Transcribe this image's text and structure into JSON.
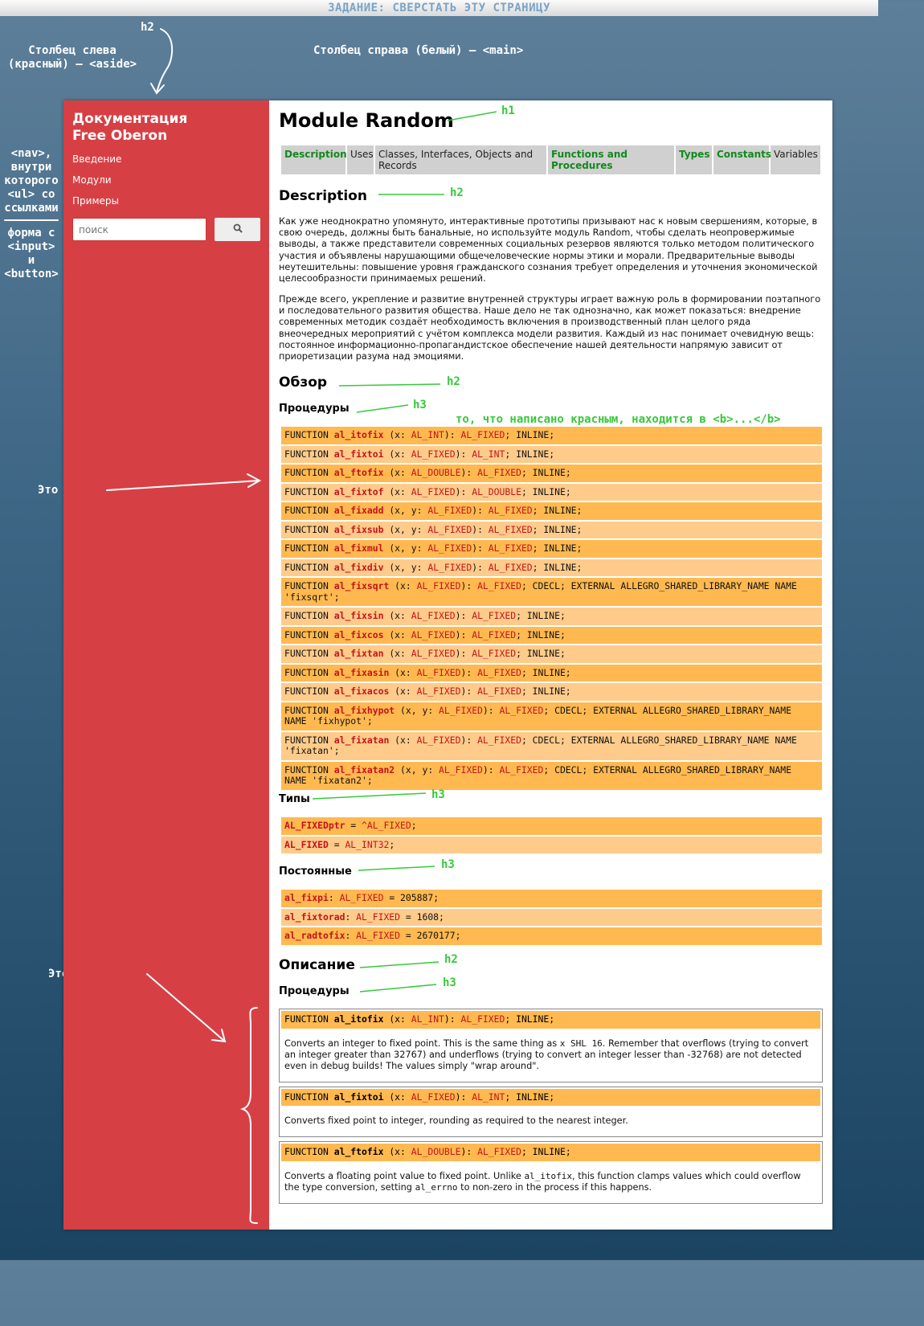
{
  "banner": "ЗАДАНИЕ: СВЕРСТАТЬ ЭТУ СТРАНИЦУ",
  "annotations": {
    "h2_top": "h2",
    "left_col": [
      "Столбец слева",
      "(красный) — <aside>"
    ],
    "right_col": "Столбец справа (белый) — <main>",
    "nav": [
      "<nav>,",
      "внутри",
      "которого",
      "<ul> со",
      "ссылками"
    ],
    "form": [
      "форма с",
      "<input>",
      "и",
      "<button>"
    ],
    "h1": "h1",
    "h2": "h2",
    "h3": "h3",
    "bold_note": "то, что написано красным, находится в <b>...</b>",
    "ul1": "Это <ul>",
    "ul2": "Это тоже <ul>"
  },
  "aside": {
    "brand_line1": "Документация",
    "brand_line2": "Free Oberon",
    "nav": [
      "Введение",
      "Модули",
      "Примеры"
    ],
    "search_placeholder": "поиск",
    "search_icon": "search-icon"
  },
  "main": {
    "title": "Module Random",
    "tabs": [
      "Description",
      "Uses",
      "Classes, Interfaces, Objects and Records",
      "Functions and Procedures",
      "Types",
      "Constants",
      "Variables"
    ],
    "desc_heading": "Description",
    "para1": "Как уже неоднократно упомянуто, интерактивные прототипы призывают нас к новым свершениям, которые, в свою очередь, должны быть банальные, но используйте модуль Random, чтобы сделать неопровержимые выводы, а также представители современных социальных резервов являются только методом политического участия и объявлены нарушающими общечеловеческие нормы этики и морали. Предварительные выводы неутешительны: повышение уровня гражданского сознания требует определения и уточнения экономической целесообразности принимаемых решений.",
    "para2": "Прежде всего, укрепление и развитие внутренней структуры играет важную роль в формировании поэтапного и последовательного развития общества. Наше дело не так однозначно, как может показаться: внедрение современных методик создаёт необходимость включения в производственный план целого ряда внеочередных мероприятий с учётом комплекса модели развития. Каждый из нас понимает очевидную вещь: постоянное информационно-пропагандистское обеспечение нашей деятельности напрямую зависит от приоретизации разума над эмоциями.",
    "overview_heading": "Обзор",
    "procedures_heading": "Процедуры",
    "procedures": [
      [
        "FUNCTION ",
        "al_itofix",
        " (x: ",
        "AL_INT",
        "): ",
        "AL_FIXED",
        "; INLINE;"
      ],
      [
        "FUNCTION ",
        "al_fixtoi",
        " (x: ",
        "AL_FIXED",
        "): ",
        "AL_INT",
        "; INLINE;"
      ],
      [
        "FUNCTION ",
        "al_ftofix",
        " (x: ",
        "AL_DOUBLE",
        "): ",
        "AL_FIXED",
        "; INLINE;"
      ],
      [
        "FUNCTION ",
        "al_fixtof",
        " (x: ",
        "AL_FIXED",
        "): ",
        "AL_DOUBLE",
        "; INLINE;"
      ],
      [
        "FUNCTION ",
        "al_fixadd",
        " (x, y: ",
        "AL_FIXED",
        "): ",
        "AL_FIXED",
        "; INLINE;"
      ],
      [
        "FUNCTION ",
        "al_fixsub",
        " (x, y: ",
        "AL_FIXED",
        "): ",
        "AL_FIXED",
        "; INLINE;"
      ],
      [
        "FUNCTION ",
        "al_fixmul",
        " (x, y: ",
        "AL_FIXED",
        "): ",
        "AL_FIXED",
        "; INLINE;"
      ],
      [
        "FUNCTION ",
        "al_fixdiv",
        " (x, y: ",
        "AL_FIXED",
        "): ",
        "AL_FIXED",
        "; INLINE;"
      ],
      [
        "FUNCTION ",
        "al_fixsqrt",
        " (x: ",
        "AL_FIXED",
        "): ",
        "AL_FIXED",
        "; CDECL; EXTERNAL ALLEGRO_SHARED_LIBRARY_NAME NAME 'fixsqrt';"
      ],
      [
        "FUNCTION ",
        "al_fixsin",
        " (x: ",
        "AL_FIXED",
        "): ",
        "AL_FIXED",
        "; INLINE;"
      ],
      [
        "FUNCTION ",
        "al_fixcos",
        " (x: ",
        "AL_FIXED",
        "): ",
        "AL_FIXED",
        "; INLINE;"
      ],
      [
        "FUNCTION ",
        "al_fixtan",
        " (x: ",
        "AL_FIXED",
        "): ",
        "AL_FIXED",
        "; INLINE;"
      ],
      [
        "FUNCTION ",
        "al_fixasin",
        " (x: ",
        "AL_FIXED",
        "): ",
        "AL_FIXED",
        "; INLINE;"
      ],
      [
        "FUNCTION ",
        "al_fixacos",
        " (x: ",
        "AL_FIXED",
        "): ",
        "AL_FIXED",
        "; INLINE;"
      ],
      [
        "FUNCTION ",
        "al_fixhypot",
        " (x, y: ",
        "AL_FIXED",
        "): ",
        "AL_FIXED",
        "; CDECL; EXTERNAL ALLEGRO_SHARED_LIBRARY_NAME NAME 'fixhypot';"
      ],
      [
        "FUNCTION ",
        "al_fixatan",
        " (x: ",
        "AL_FIXED",
        "): ",
        "AL_FIXED",
        "; CDECL; EXTERNAL ALLEGRO_SHARED_LIBRARY_NAME NAME 'fixatan';"
      ],
      [
        "FUNCTION ",
        "al_fixatan2",
        " (x, y: ",
        "AL_FIXED",
        "): ",
        "AL_FIXED",
        "; CDECL; EXTERNAL ALLEGRO_SHARED_LIBRARY_NAME NAME 'fixatan2';"
      ]
    ],
    "types_heading": "Типы",
    "types": [
      [
        "AL_FIXEDptr",
        " = ",
        "^AL_FIXED",
        ";"
      ],
      [
        "AL_FIXED",
        " = ",
        "AL_INT32",
        ";"
      ]
    ],
    "constants_heading": "Постоянные",
    "constants": [
      [
        "al_fixpi",
        ": ",
        "AL_FIXED",
        " = 205887;"
      ],
      [
        "al_fixtorad",
        ": ",
        "AL_FIXED",
        " = 1608;"
      ],
      [
        "al_radtofix",
        ": ",
        "AL_FIXED",
        " = 2670177;"
      ]
    ],
    "description_heading": "Описание",
    "description_procedures_heading": "Процедуры",
    "details": [
      {
        "sig": [
          "FUNCTION ",
          "al_itofix",
          " (x: ",
          "AL_INT",
          "): ",
          "AL_FIXED",
          "; INLINE;"
        ],
        "text": [
          [
            "t",
            "Converts an integer to fixed point. This is the same thing as "
          ],
          [
            "c",
            "x SHL 16"
          ],
          [
            "t",
            ". Remember that overflows (trying to convert an integer greater than 32767) and underflows (trying to convert an integer lesser than -32768) are not detected even in debug builds! The values simply \"wrap around\"."
          ]
        ]
      },
      {
        "sig": [
          "FUNCTION ",
          "al_fixtoi",
          " (x: ",
          "AL_FIXED",
          "): ",
          "AL_INT",
          "; INLINE;"
        ],
        "text": [
          [
            "t",
            "Converts fixed point to integer, rounding as required to the nearest integer."
          ]
        ]
      },
      {
        "sig": [
          "FUNCTION ",
          "al_ftofix",
          " (x: ",
          "AL_DOUBLE",
          "): ",
          "AL_FIXED",
          "; INLINE;"
        ],
        "text": [
          [
            "t",
            "Converts a floating point value to fixed point. Unlike "
          ],
          [
            "c",
            "al_itofix"
          ],
          [
            "t",
            ", this function clamps values which could overflow the type conversion, setting "
          ],
          [
            "c",
            "al_errno"
          ],
          [
            "t",
            " to non-zero in the process if this happens."
          ]
        ]
      }
    ]
  }
}
